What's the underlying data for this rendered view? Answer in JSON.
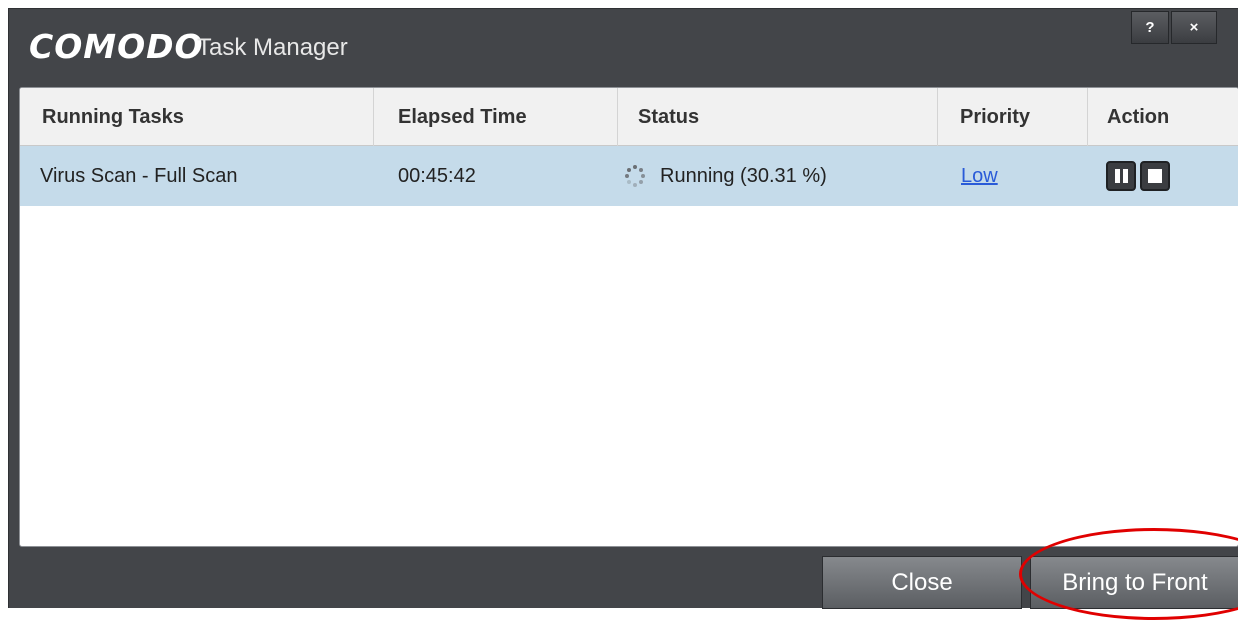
{
  "window": {
    "brand": "COMODO",
    "title": "Task Manager",
    "help_label": "?",
    "close_label": "×"
  },
  "table": {
    "columns": [
      "Running Tasks",
      "Elapsed Time",
      "Status",
      "Priority",
      "Action"
    ],
    "rows": [
      {
        "task": "Virus Scan - Full Scan",
        "elapsed": "00:45:42",
        "status": "Running (30.31 %)",
        "priority": "Low",
        "actions": [
          "pause-icon",
          "stop-icon"
        ]
      }
    ]
  },
  "footer": {
    "close_label": "Close",
    "bring_to_front_label": "Bring to Front"
  },
  "colors": {
    "window_bg": "#434549",
    "selected_row": "#c5dbea",
    "link": "#2a5bd8",
    "highlight": "#e00000"
  }
}
